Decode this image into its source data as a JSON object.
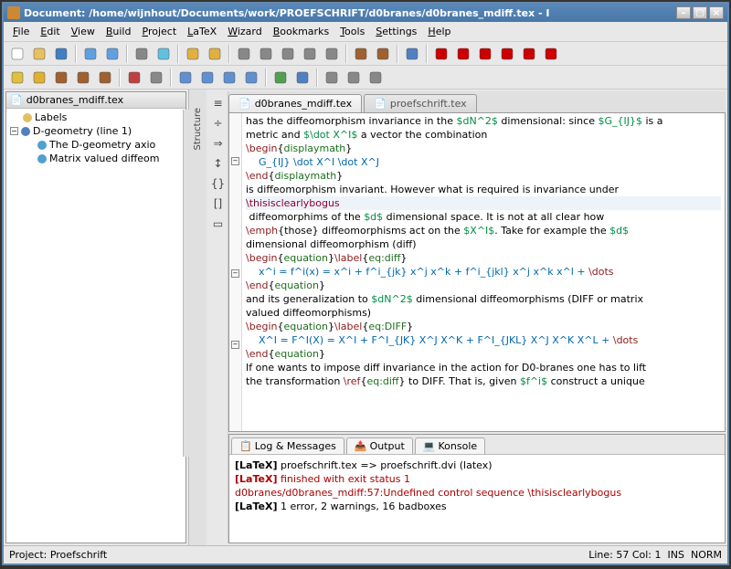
{
  "window": {
    "title": "Document: /home/wijnhout/Documents/work/PROEFSCHRIFT/d0branes/d0branes_mdiff.tex - I"
  },
  "menu": [
    "File",
    "Edit",
    "View",
    "Build",
    "Project",
    "LaTeX",
    "Wizard",
    "Bookmarks",
    "Tools",
    "Settings",
    "Help"
  ],
  "tree": {
    "header": "d0branes_mdiff.tex",
    "items": [
      {
        "indent": 0,
        "exp": "",
        "icon": "label",
        "text": "Labels"
      },
      {
        "indent": 0,
        "exp": "-",
        "icon": "sect",
        "text": "D-geometry (line 1)"
      },
      {
        "indent": 1,
        "exp": "",
        "icon": "sub",
        "text": "The D-geometry axio"
      },
      {
        "indent": 1,
        "exp": "",
        "icon": "sub",
        "text": "Matrix valued diffeom"
      }
    ],
    "vtab": "Structure"
  },
  "editor": {
    "tabs": [
      {
        "label": "d0branes_mdiff.tex",
        "active": true
      },
      {
        "label": "proefschrift.tex",
        "active": false
      }
    ],
    "lines": [
      {
        "fold": "",
        "html": "has the diffeomorphism invariance in the <span class='mt'>$dN^2$</span> dimensional: since <span class='mt'>$G_{IJ}$</span> is a"
      },
      {
        "fold": "",
        "html": "metric and <span class='mt'>$\\dot X^I$</span> a vector the combination"
      },
      {
        "fold": "-",
        "html": "<span class='kw'>\\begin</span>{<span class='br'>displaymath</span>}"
      },
      {
        "fold": "",
        "html": "    <span class='mv'>G_{IJ} \\dot X^I \\dot X^J</span>"
      },
      {
        "fold": "",
        "html": "<span class='kw'>\\end</span>{<span class='br'>displaymath</span>}"
      },
      {
        "fold": "",
        "html": "is diffeomorphism invariant. However what is required is invariance under"
      },
      {
        "fold": "",
        "hl": true,
        "html": "<span class='err'>\\thisisclearlybogus</span>"
      },
      {
        "fold": "",
        "html": " diffeomorphims of the <span class='mt'>$d$</span> dimensional space. It is not at all clear how"
      },
      {
        "fold": "",
        "html": "<span class='kw'>\\emph</span>{those} diffeomorphisms act on the <span class='mt'>$X^I$</span>. Take for example the <span class='mt'>$d$</span>"
      },
      {
        "fold": "",
        "html": "dimensional diffeomorphism (diff)"
      },
      {
        "fold": "-",
        "html": "<span class='kw'>\\begin</span>{<span class='br'>equation</span>}<span class='kw'>\\label</span>{<span class='br'>eq:diff</span>}"
      },
      {
        "fold": "",
        "html": "    <span class='mv'>x^i = f^i(x) = x^i + f^i_{jk} x^j x^k + f^i_{jkl} x^j x^k x^l + </span><span class='kw'>\\dots</span>"
      },
      {
        "fold": "",
        "html": "<span class='kw'>\\end</span>{<span class='br'>equation</span>}"
      },
      {
        "fold": "",
        "html": "and its generalization to <span class='mt'>$dN^2$</span> dimensional diffeomorphisms (DIFF or matrix"
      },
      {
        "fold": "",
        "html": "valued diffeomorphisms)"
      },
      {
        "fold": "-",
        "html": "<span class='kw'>\\begin</span>{<span class='br'>equation</span>}<span class='kw'>\\label</span>{<span class='br'>eq:DIFF</span>}"
      },
      {
        "fold": "",
        "html": "    <span class='mv'>X^I = F^I(X) = X^I + F^I_{JK} X^J X^K + F^I_{JKL} X^J X^K X^L + </span><span class='kw'>\\dots</span>"
      },
      {
        "fold": "",
        "html": "<span class='kw'>\\end</span>{<span class='br'>equation</span>}"
      },
      {
        "fold": "",
        "html": "If one wants to impose diff invariance in the action for D0-branes one has to lift"
      },
      {
        "fold": "",
        "html": "the transformation <span class='kw'>\\ref</span>{<span class='br'>eq:diff</span>} to DIFF. That is, given <span class='mt'>$f^i$</span> construct a unique"
      }
    ]
  },
  "log": {
    "tabs": [
      "Log & Messages",
      "Output",
      "Konsole"
    ],
    "lines": [
      {
        "cls": "",
        "html": "<span class='b'>[LaTeX]</span> proefschrift.tex =&gt; proefschrift.dvi (latex)"
      },
      {
        "cls": "r",
        "html": "<span class='b'>[LaTeX]</span> finished with exit status 1"
      },
      {
        "cls": "r",
        "html": "d0branes/d0branes_mdiff:57:Undefined control sequence \\thisisclearlybogus"
      },
      {
        "cls": "",
        "html": "<span class='b'>[LaTeX]</span> 1 error, 2 warnings, 16 badboxes"
      }
    ]
  },
  "status": {
    "project": "Project: Proefschrift",
    "pos": "Line: 57 Col: 1",
    "mode1": "INS",
    "mode2": "NORM"
  },
  "icons": {
    "toolbar1": [
      "new",
      "open",
      "save",
      "",
      "back",
      "fwd",
      "",
      "print",
      "viewdvi",
      "",
      "undo",
      "redo",
      "",
      "find",
      "findnext",
      "findprev",
      "zoomin",
      "zoomout",
      "",
      "d1",
      "d2",
      "",
      "build",
      "",
      "ex1",
      "ex2",
      "ex3",
      "ex4",
      "ex5",
      "ex6"
    ],
    "toolbar2": [
      "bolt",
      "star",
      "cog1",
      "cog2",
      "cog3",
      "",
      "pdf",
      "x1",
      "",
      "bk1",
      "bk2",
      "bk3",
      "bk4",
      "",
      "gl1",
      "gl2",
      "",
      "p1",
      "p2",
      "p3"
    ]
  }
}
